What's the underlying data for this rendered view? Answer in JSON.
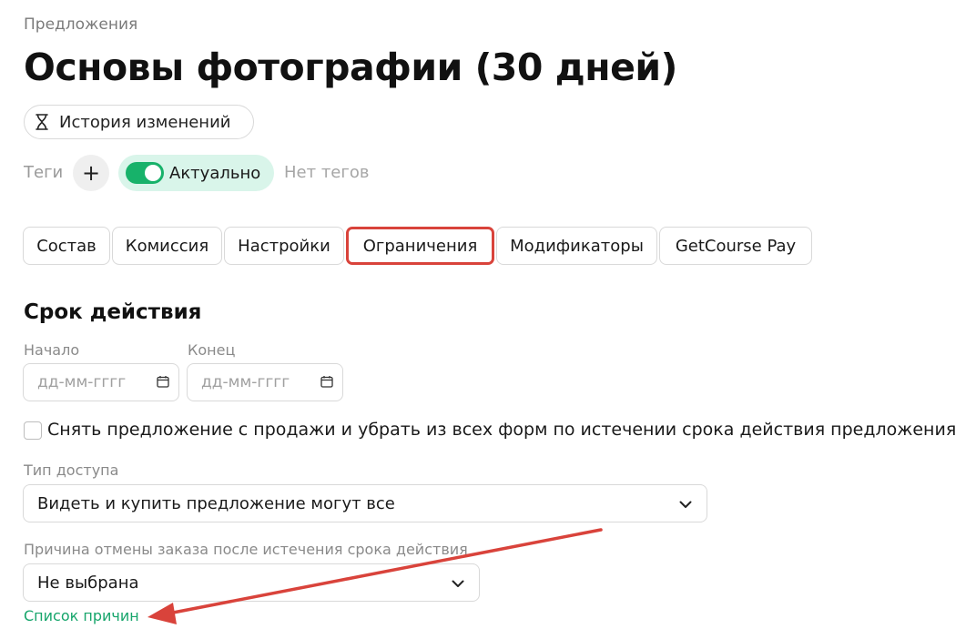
{
  "breadcrumb": "Предложения",
  "page_title": "Основы фотографии (30 дней)",
  "history_button": {
    "label": "История изменений",
    "icon": "hourglass-icon"
  },
  "tags": {
    "label": "Теги",
    "add_icon": "plus-icon",
    "status_label": "Актуально",
    "status_on": true,
    "empty_text": "Нет тегов"
  },
  "tabs": [
    {
      "label": "Состав",
      "active": false
    },
    {
      "label": "Комиссия",
      "active": false
    },
    {
      "label": "Настройки",
      "active": false
    },
    {
      "label": "Ограничения",
      "active": true
    },
    {
      "label": "Модификаторы",
      "active": false
    },
    {
      "label": "GetCourse Pay",
      "active": false
    }
  ],
  "validity": {
    "section_title": "Срок действия",
    "start_label": "Начало",
    "start_placeholder": "дд-мм-гггг",
    "end_label": "Конец",
    "end_placeholder": "дд-мм-гггг",
    "calendar_icon": "calendar-icon",
    "checkbox_label": "Снять предложение с продажи и убрать из всех форм по истечении срока действия предложения",
    "checkbox_checked": false
  },
  "access": {
    "label": "Тип доступа",
    "value": "Видеть и купить предложение могут все"
  },
  "cancel_reason": {
    "label": "Причина отмены заказа после истечения срока действия",
    "value": "Не выбрана",
    "link": "Список причин"
  },
  "colors": {
    "accent_green": "#17b26a",
    "highlight_red": "#d9433b",
    "link_green": "#16a56b"
  },
  "annotation": {
    "type": "arrow",
    "color": "#d9433b"
  }
}
